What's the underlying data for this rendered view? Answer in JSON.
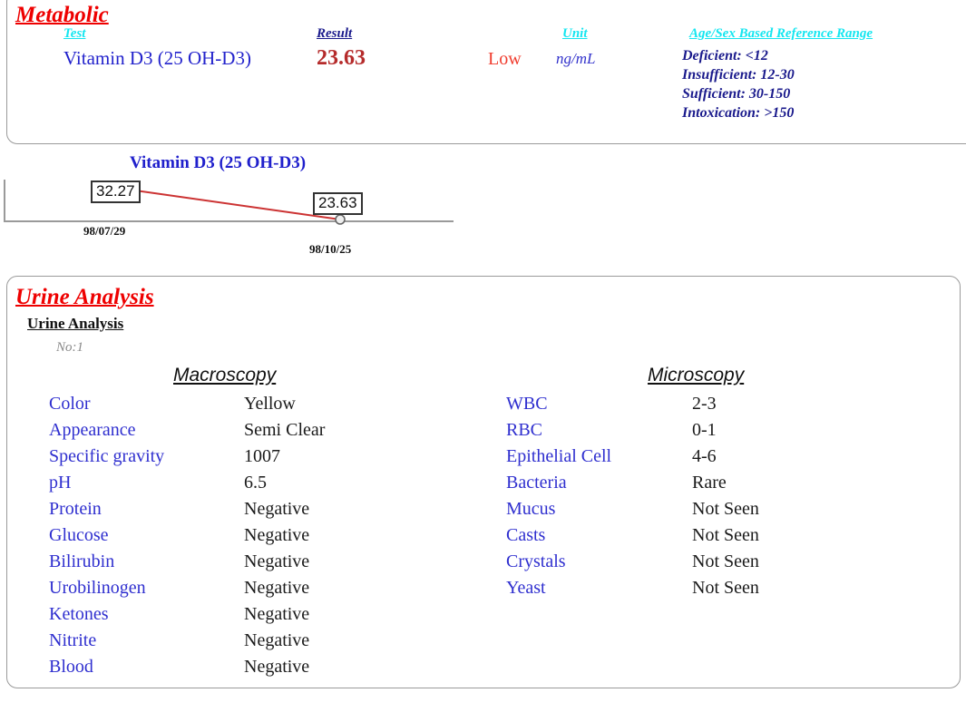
{
  "metabolic": {
    "section_title": "Metabolic",
    "headers": {
      "test": "Test",
      "result": "Result",
      "unit": "Unit",
      "reference_range": "Age/Sex Based Reference Range"
    },
    "row": {
      "test": "Vitamin D3 (25 OH-D3)",
      "result": "23.63",
      "flag": "Low",
      "unit": "ng/mL",
      "reference_lines": [
        "Deficient: <12",
        "Insufficient: 12-30",
        "Sufficient: 30-150",
        "Intoxication: >150"
      ]
    },
    "colors": {
      "section_title": "#ee0000",
      "header_cyan": "#15e6f0",
      "header_navy": "#1a1a8c",
      "test_name": "#2222cc",
      "result": "#b52b2b",
      "flag": "#f03c2e"
    }
  },
  "chart_data": {
    "type": "line",
    "title": "Vitamin D3 (25 OH-D3)",
    "xlabel": "",
    "ylabel": "",
    "x": [
      "98/07/29",
      "98/10/25"
    ],
    "categories": [
      "98/07/29",
      "98/10/25"
    ],
    "values": [
      32.27,
      23.63
    ],
    "point_labels": [
      "32.27",
      "23.63"
    ],
    "series": [
      {
        "name": "Vitamin D3 (25 OH-D3)",
        "values": [
          32.27,
          23.63
        ]
      }
    ],
    "line_color": "#cc3333",
    "marker_color": "#888888",
    "axis_color": "#9a9a9a",
    "grid": false,
    "legend": false
  },
  "urine": {
    "section_title": "Urine Analysis",
    "subtitle": "Urine Analysis",
    "sample_no": "No:1",
    "macroscopy": {
      "heading": "Macroscopy",
      "rows": [
        {
          "label": "Color",
          "value": "Yellow"
        },
        {
          "label": "Appearance",
          "value": "Semi Clear"
        },
        {
          "label": "Specific gravity",
          "value": "1007"
        },
        {
          "label": "pH",
          "value": "6.5"
        },
        {
          "label": "Protein",
          "value": "Negative"
        },
        {
          "label": "Glucose",
          "value": "Negative"
        },
        {
          "label": "Bilirubin",
          "value": "Negative"
        },
        {
          "label": "Urobilinogen",
          "value": "Negative"
        },
        {
          "label": "Ketones",
          "value": "Negative"
        },
        {
          "label": "Nitrite",
          "value": "Negative"
        },
        {
          "label": "Blood",
          "value": "Negative"
        }
      ]
    },
    "microscopy": {
      "heading": "Microscopy",
      "rows": [
        {
          "label": "WBC",
          "value": "2-3"
        },
        {
          "label": "RBC",
          "value": "0-1"
        },
        {
          "label": "Epithelial Cell",
          "value": "4-6"
        },
        {
          "label": "Bacteria",
          "value": "Rare"
        },
        {
          "label": "Mucus",
          "value": "Not Seen"
        },
        {
          "label": "Casts",
          "value": "Not Seen"
        },
        {
          "label": "Crystals",
          "value": "Not Seen"
        },
        {
          "label": "Yeast",
          "value": "Not Seen"
        }
      ]
    },
    "colors": {
      "section_title": "#ee0000",
      "label": "#2f2fcf",
      "value": "#1a1a1a",
      "sample_no": "#8a8a8a"
    }
  }
}
